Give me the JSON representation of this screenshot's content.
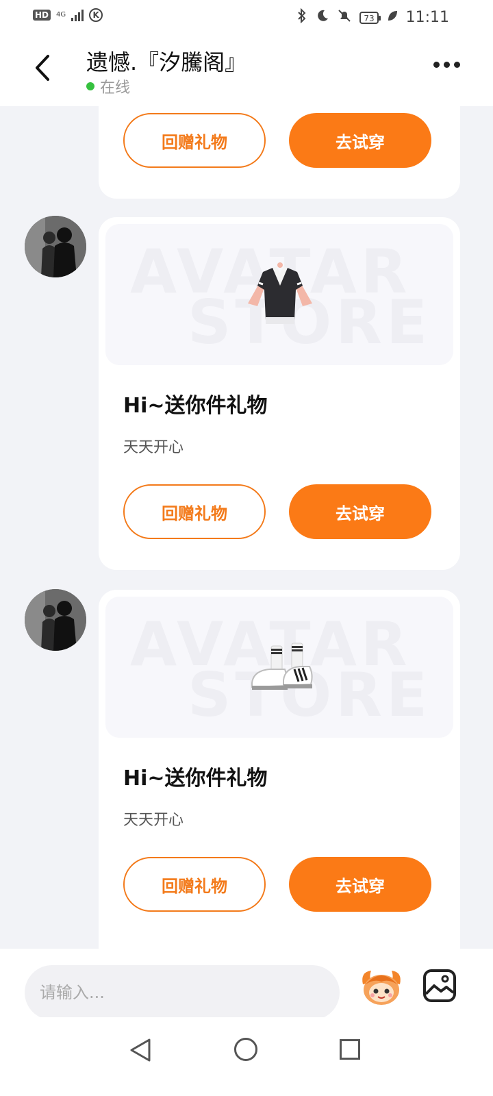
{
  "status_bar": {
    "hd": "HD",
    "network": "4G",
    "battery": "73",
    "time": "11:11"
  },
  "header": {
    "title": "遗憾.『汐騰阁』",
    "status": "在线"
  },
  "gift_cards": [
    {
      "title": "",
      "subtitle": "",
      "item": "",
      "return_label": "回赠礼物",
      "try_label": "去试穿"
    },
    {
      "title": "Hi~送你件礼物",
      "subtitle": "天天开心",
      "item": "jacket",
      "watermark_line1": "AVATAR",
      "watermark_line2": "STORE",
      "return_label": "回赠礼物",
      "try_label": "去试穿"
    },
    {
      "title": "Hi~送你件礼物",
      "subtitle": "天天开心",
      "item": "sneakers",
      "watermark_line1": "AVATAR",
      "watermark_line2": "STORE",
      "return_label": "回赠礼物",
      "try_label": "去试穿"
    }
  ],
  "input": {
    "placeholder": "请输入..."
  },
  "icons": {
    "back": "chevron-left-icon",
    "more": "more-dots-icon",
    "emoji": "mascot-emoji-icon",
    "image": "image-icon"
  },
  "colors": {
    "accent": "#fb7a16",
    "online": "#36c13f",
    "background": "#f2f3f7"
  }
}
